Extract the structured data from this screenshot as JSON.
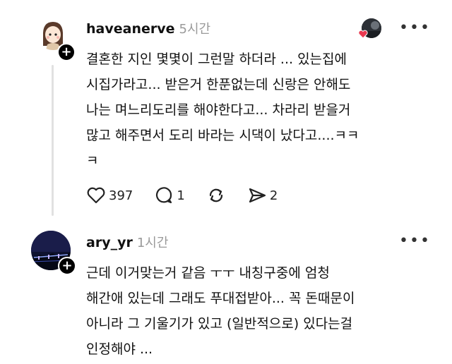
{
  "post1": {
    "username": "haveanerve",
    "time": "5시간",
    "text": "결혼한 지인 몇몇이 그런말 하더라 ... 있는집에\n시집가라고... 받은거 한푼없는데 신랑은 안해도\n나는 며느리도리를 해야한다고... 차라리 받을거\n많고 해주면서 도리 바라는 시댁이 났다고....ㅋㅋ\nㅋ",
    "likes": "397",
    "replies": "1",
    "shares": "2",
    "more": "•••"
  },
  "post2": {
    "username": "ary_yr",
    "time": "1시간",
    "text": "근데 이거맞는거 같음 ㅜㅜ 내칭구중에 엄청\n해간애 있는데 그래도 푸대접받아... 꼭 돈때문이\n아니라 그 기울기가 있고 (일반적으로) 있다는걸\n인정해야 ...",
    "more": "•••"
  },
  "icons": {
    "plus": "+",
    "like": "heart-icon",
    "reply": "comment-icon",
    "repost": "repost-icon",
    "share": "send-icon"
  }
}
